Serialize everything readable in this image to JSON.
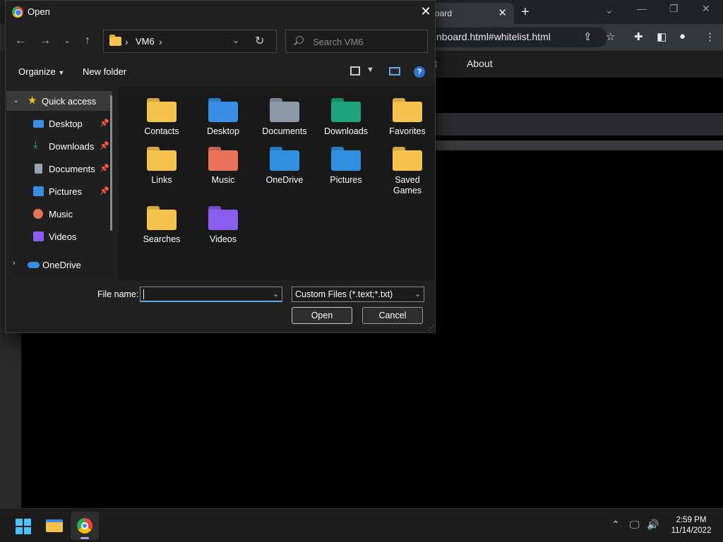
{
  "browser": {
    "tab_title": "oard",
    "url": "nboard.html#whitelist.html",
    "nav_items": [
      "t",
      "About"
    ]
  },
  "dialog": {
    "title": "Open",
    "breadcrumb": "VM6",
    "search_placeholder": "Search VM6",
    "organize_label": "Organize",
    "new_folder_label": "New folder",
    "nav_items": [
      {
        "label": "Quick access",
        "icon": "star-icon",
        "color": "#f5c518"
      },
      {
        "label": "Desktop",
        "icon": "desktop-icon",
        "color": "#3a8ee6",
        "pinned": true
      },
      {
        "label": "Downloads",
        "icon": "download-icon",
        "color": "#2bb673",
        "pinned": true
      },
      {
        "label": "Documents",
        "icon": "documents-icon",
        "color": "#9aa3b0",
        "pinned": true
      },
      {
        "label": "Pictures",
        "icon": "pictures-icon",
        "color": "#3a8ee6",
        "pinned": true
      },
      {
        "label": "Music",
        "icon": "music-icon",
        "color": "#e8735a"
      },
      {
        "label": "Videos",
        "icon": "videos-icon",
        "color": "#8a5cf0"
      },
      {
        "label": "OneDrive",
        "icon": "onedrive-icon",
        "color": "#3a8ee6"
      }
    ],
    "files": [
      {
        "label": "Contacts",
        "icon": "folder-icon",
        "color": "#f6c34f"
      },
      {
        "label": "Desktop",
        "icon": "desktop-folder-icon",
        "color": "#3a8ee6"
      },
      {
        "label": "Documents",
        "icon": "documents-folder-icon",
        "color": "#8d98a8"
      },
      {
        "label": "Downloads",
        "icon": "downloads-folder-icon",
        "color": "#1fa37a"
      },
      {
        "label": "Favorites",
        "icon": "folder-icon",
        "color": "#f6c34f"
      },
      {
        "label": "Links",
        "icon": "folder-icon",
        "color": "#f6c34f"
      },
      {
        "label": "Music",
        "icon": "music-folder-icon",
        "color": "#e8735a"
      },
      {
        "label": "OneDrive",
        "icon": "onedrive-folder-icon",
        "color": "#2f8fe0"
      },
      {
        "label": "Pictures",
        "icon": "pictures-folder-icon",
        "color": "#2f8fe0"
      },
      {
        "label": "Saved Games",
        "icon": "folder-icon",
        "color": "#f6c34f"
      },
      {
        "label": "Searches",
        "icon": "folder-icon",
        "color": "#f6c34f"
      },
      {
        "label": "Videos",
        "icon": "videos-folder-icon",
        "color": "#8a5cf0"
      }
    ],
    "file_name_label": "File name:",
    "file_name_value": "",
    "filter_value": "Custom Files (*.text;*.txt)",
    "open_label": "Open",
    "cancel_label": "Cancel"
  },
  "taskbar": {
    "time": "2:59 PM",
    "date": "11/14/2022"
  }
}
